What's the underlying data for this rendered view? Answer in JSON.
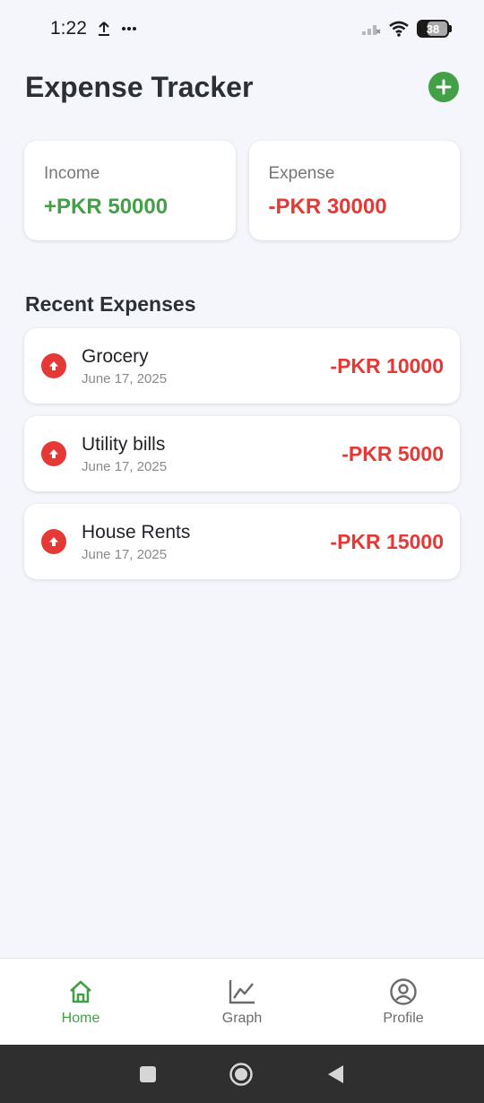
{
  "status_bar": {
    "time": "1:22",
    "battery": "38"
  },
  "header": {
    "title": "Expense Tracker",
    "add_icon": "plus-circle-icon"
  },
  "summary": {
    "income": {
      "label": "Income",
      "value": "+PKR 50000"
    },
    "expense": {
      "label": "Expense",
      "value": "-PKR 30000"
    }
  },
  "recent": {
    "title": "Recent Expenses",
    "items": [
      {
        "name": "Grocery",
        "date": "June 17, 2025",
        "amount": "-PKR 10000"
      },
      {
        "name": "Utility bills",
        "date": "June 17, 2025",
        "amount": "-PKR 5000"
      },
      {
        "name": "House Rents",
        "date": "June 17, 2025",
        "amount": "-PKR 15000"
      }
    ]
  },
  "nav": {
    "items": [
      {
        "label": "Home",
        "icon": "home-icon",
        "active": true
      },
      {
        "label": "Graph",
        "icon": "line-chart-icon",
        "active": false
      },
      {
        "label": "Profile",
        "icon": "user-circle-icon",
        "active": false
      }
    ]
  },
  "colors": {
    "accent_green": "#43a047",
    "expense_red": "#e53935",
    "background": "#f4f6fb"
  }
}
